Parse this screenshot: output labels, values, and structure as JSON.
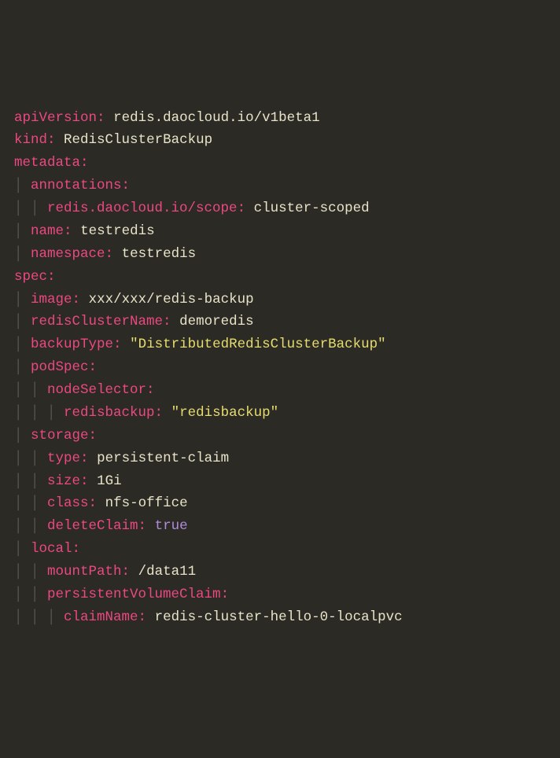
{
  "yaml": {
    "line1_key": "apiVersion",
    "line1_val": "redis.daocloud.io/v1beta1",
    "line2_key": "kind",
    "line2_val": "RedisClusterBackup",
    "line3_key": "metadata",
    "line4_key": "annotations",
    "line5_key": "redis.daocloud.io/scope",
    "line5_val": "cluster-scoped",
    "line6_key": "name",
    "line6_val": "testredis",
    "line7_key": "namespace",
    "line7_val": "testredis",
    "line8_key": "spec",
    "line9_key": "image",
    "line9_val": "xxx/xxx/redis-backup",
    "line10_key": "redisClusterName",
    "line10_val": "demoredis",
    "line11_key": "backupType",
    "line11_val": "\"DistributedRedisClusterBackup\"",
    "line12_key": "podSpec",
    "line13_key": "nodeSelector",
    "line14_key": "redisbackup",
    "line14_val": "\"redisbackup\"",
    "line15_key": "storage",
    "line16_key": "type",
    "line16_val": "persistent-claim",
    "line17_key": "size",
    "line17_val": "1Gi",
    "line18_key": "class",
    "line18_val": "nfs-office",
    "line19_key": "deleteClaim",
    "line19_val": "true",
    "line20_key": "local",
    "line21_key": "mountPath",
    "line21_val": "/data11",
    "line22_key": "persistentVolumeClaim",
    "line23_key": "claimName",
    "line23_val": "redis-cluster-hello-0-localpvc"
  }
}
